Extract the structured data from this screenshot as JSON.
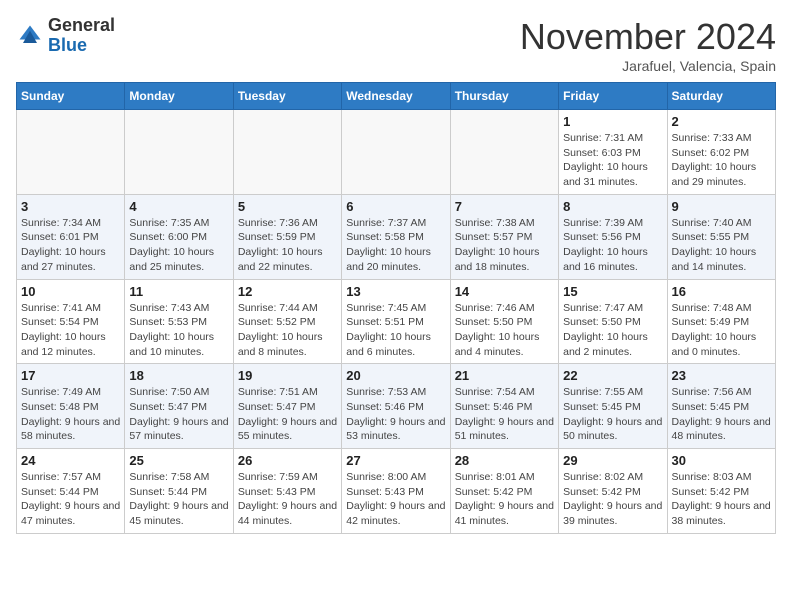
{
  "header": {
    "logo_general": "General",
    "logo_blue": "Blue",
    "month": "November 2024",
    "location": "Jarafuel, Valencia, Spain"
  },
  "weekdays": [
    "Sunday",
    "Monday",
    "Tuesday",
    "Wednesday",
    "Thursday",
    "Friday",
    "Saturday"
  ],
  "weeks": [
    [
      {
        "day": "",
        "empty": true
      },
      {
        "day": "",
        "empty": true
      },
      {
        "day": "",
        "empty": true
      },
      {
        "day": "",
        "empty": true
      },
      {
        "day": "",
        "empty": true
      },
      {
        "day": "1",
        "sunrise": "Sunrise: 7:31 AM",
        "sunset": "Sunset: 6:03 PM",
        "daylight": "Daylight: 10 hours and 31 minutes."
      },
      {
        "day": "2",
        "sunrise": "Sunrise: 7:33 AM",
        "sunset": "Sunset: 6:02 PM",
        "daylight": "Daylight: 10 hours and 29 minutes."
      }
    ],
    [
      {
        "day": "3",
        "sunrise": "Sunrise: 7:34 AM",
        "sunset": "Sunset: 6:01 PM",
        "daylight": "Daylight: 10 hours and 27 minutes."
      },
      {
        "day": "4",
        "sunrise": "Sunrise: 7:35 AM",
        "sunset": "Sunset: 6:00 PM",
        "daylight": "Daylight: 10 hours and 25 minutes."
      },
      {
        "day": "5",
        "sunrise": "Sunrise: 7:36 AM",
        "sunset": "Sunset: 5:59 PM",
        "daylight": "Daylight: 10 hours and 22 minutes."
      },
      {
        "day": "6",
        "sunrise": "Sunrise: 7:37 AM",
        "sunset": "Sunset: 5:58 PM",
        "daylight": "Daylight: 10 hours and 20 minutes."
      },
      {
        "day": "7",
        "sunrise": "Sunrise: 7:38 AM",
        "sunset": "Sunset: 5:57 PM",
        "daylight": "Daylight: 10 hours and 18 minutes."
      },
      {
        "day": "8",
        "sunrise": "Sunrise: 7:39 AM",
        "sunset": "Sunset: 5:56 PM",
        "daylight": "Daylight: 10 hours and 16 minutes."
      },
      {
        "day": "9",
        "sunrise": "Sunrise: 7:40 AM",
        "sunset": "Sunset: 5:55 PM",
        "daylight": "Daylight: 10 hours and 14 minutes."
      }
    ],
    [
      {
        "day": "10",
        "sunrise": "Sunrise: 7:41 AM",
        "sunset": "Sunset: 5:54 PM",
        "daylight": "Daylight: 10 hours and 12 minutes."
      },
      {
        "day": "11",
        "sunrise": "Sunrise: 7:43 AM",
        "sunset": "Sunset: 5:53 PM",
        "daylight": "Daylight: 10 hours and 10 minutes."
      },
      {
        "day": "12",
        "sunrise": "Sunrise: 7:44 AM",
        "sunset": "Sunset: 5:52 PM",
        "daylight": "Daylight: 10 hours and 8 minutes."
      },
      {
        "day": "13",
        "sunrise": "Sunrise: 7:45 AM",
        "sunset": "Sunset: 5:51 PM",
        "daylight": "Daylight: 10 hours and 6 minutes."
      },
      {
        "day": "14",
        "sunrise": "Sunrise: 7:46 AM",
        "sunset": "Sunset: 5:50 PM",
        "daylight": "Daylight: 10 hours and 4 minutes."
      },
      {
        "day": "15",
        "sunrise": "Sunrise: 7:47 AM",
        "sunset": "Sunset: 5:50 PM",
        "daylight": "Daylight: 10 hours and 2 minutes."
      },
      {
        "day": "16",
        "sunrise": "Sunrise: 7:48 AM",
        "sunset": "Sunset: 5:49 PM",
        "daylight": "Daylight: 10 hours and 0 minutes."
      }
    ],
    [
      {
        "day": "17",
        "sunrise": "Sunrise: 7:49 AM",
        "sunset": "Sunset: 5:48 PM",
        "daylight": "Daylight: 9 hours and 58 minutes."
      },
      {
        "day": "18",
        "sunrise": "Sunrise: 7:50 AM",
        "sunset": "Sunset: 5:47 PM",
        "daylight": "Daylight: 9 hours and 57 minutes."
      },
      {
        "day": "19",
        "sunrise": "Sunrise: 7:51 AM",
        "sunset": "Sunset: 5:47 PM",
        "daylight": "Daylight: 9 hours and 55 minutes."
      },
      {
        "day": "20",
        "sunrise": "Sunrise: 7:53 AM",
        "sunset": "Sunset: 5:46 PM",
        "daylight": "Daylight: 9 hours and 53 minutes."
      },
      {
        "day": "21",
        "sunrise": "Sunrise: 7:54 AM",
        "sunset": "Sunset: 5:46 PM",
        "daylight": "Daylight: 9 hours and 51 minutes."
      },
      {
        "day": "22",
        "sunrise": "Sunrise: 7:55 AM",
        "sunset": "Sunset: 5:45 PM",
        "daylight": "Daylight: 9 hours and 50 minutes."
      },
      {
        "day": "23",
        "sunrise": "Sunrise: 7:56 AM",
        "sunset": "Sunset: 5:45 PM",
        "daylight": "Daylight: 9 hours and 48 minutes."
      }
    ],
    [
      {
        "day": "24",
        "sunrise": "Sunrise: 7:57 AM",
        "sunset": "Sunset: 5:44 PM",
        "daylight": "Daylight: 9 hours and 47 minutes."
      },
      {
        "day": "25",
        "sunrise": "Sunrise: 7:58 AM",
        "sunset": "Sunset: 5:44 PM",
        "daylight": "Daylight: 9 hours and 45 minutes."
      },
      {
        "day": "26",
        "sunrise": "Sunrise: 7:59 AM",
        "sunset": "Sunset: 5:43 PM",
        "daylight": "Daylight: 9 hours and 44 minutes."
      },
      {
        "day": "27",
        "sunrise": "Sunrise: 8:00 AM",
        "sunset": "Sunset: 5:43 PM",
        "daylight": "Daylight: 9 hours and 42 minutes."
      },
      {
        "day": "28",
        "sunrise": "Sunrise: 8:01 AM",
        "sunset": "Sunset: 5:42 PM",
        "daylight": "Daylight: 9 hours and 41 minutes."
      },
      {
        "day": "29",
        "sunrise": "Sunrise: 8:02 AM",
        "sunset": "Sunset: 5:42 PM",
        "daylight": "Daylight: 9 hours and 39 minutes."
      },
      {
        "day": "30",
        "sunrise": "Sunrise: 8:03 AM",
        "sunset": "Sunset: 5:42 PM",
        "daylight": "Daylight: 9 hours and 38 minutes."
      }
    ]
  ]
}
